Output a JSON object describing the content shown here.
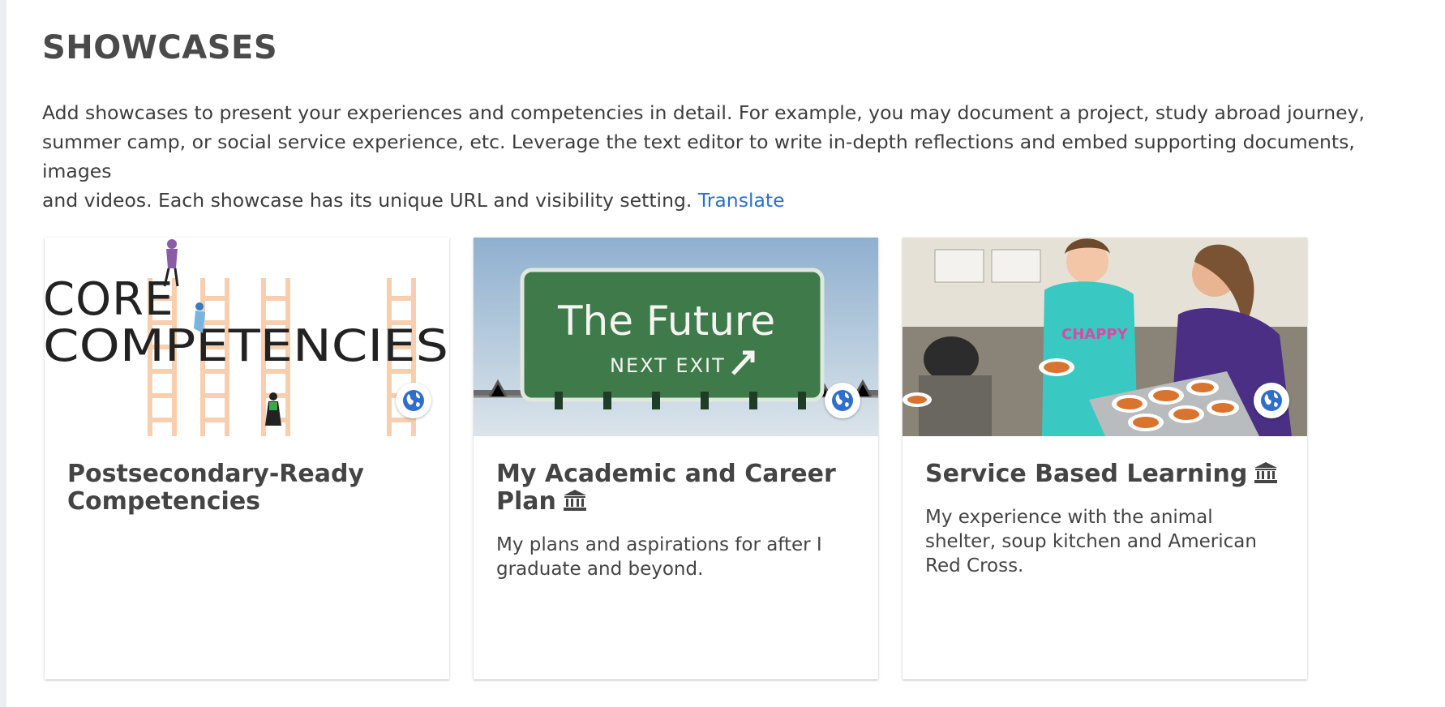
{
  "page": {
    "title": "SHOWCASES",
    "intro_lines": [
      "Add showcases to present your experiences and competencies in detail. For example, you may document a project, study abroad journey,",
      "summer camp, or social service experience, etc. Leverage the text editor to write in-depth reflections and embed supporting documents, images",
      "and videos. Each showcase has its unique URL and visibility setting."
    ],
    "translate_link": "Translate"
  },
  "showcases": [
    {
      "title": "Postsecondary-Ready Competencies",
      "description": "",
      "institution_icon": false,
      "visibility_icon": "globe-icon",
      "image_text": [
        "CORE",
        "COMPETENCIES"
      ]
    },
    {
      "title": "My Academic and Career Plan",
      "description": "My plans and aspirations for after I graduate and beyond.",
      "institution_icon": true,
      "visibility_icon": "globe-icon",
      "image_text": [
        "The Future",
        "NEXT EXIT"
      ]
    },
    {
      "title": "Service Based Learning",
      "description": "My experience with the animal shelter, soup kitchen and American Red Cross.",
      "institution_icon": true,
      "visibility_icon": "globe-icon",
      "image_text": [
        "CHAPPY"
      ]
    }
  ],
  "colors": {
    "link": "#2f6fc9",
    "globe": "#2f6fc9",
    "sign_green": "#3f7a4a",
    "core_red": "#e8242b",
    "ladder": "#f7cfae"
  }
}
